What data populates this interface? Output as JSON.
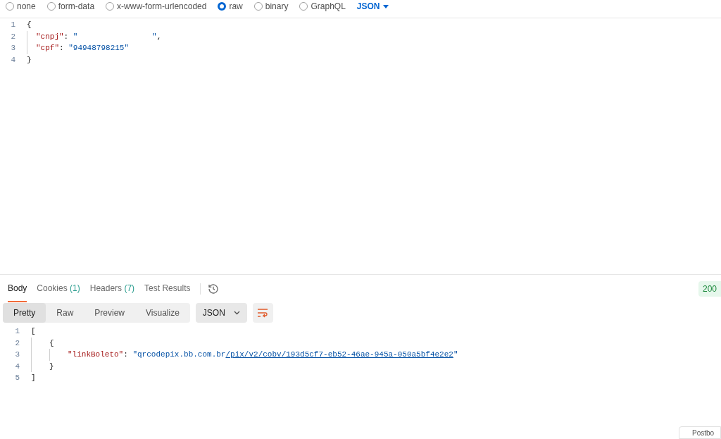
{
  "body_types": [
    {
      "label": "none",
      "selected": false
    },
    {
      "label": "form-data",
      "selected": false
    },
    {
      "label": "x-www-form-urlencoded",
      "selected": false
    },
    {
      "label": "raw",
      "selected": true
    },
    {
      "label": "binary",
      "selected": false
    },
    {
      "label": "GraphQL",
      "selected": false
    }
  ],
  "language_dropdown": "JSON",
  "request_lines": [
    {
      "number": "1",
      "segments": [
        {
          "kind": "punct",
          "text": "{"
        }
      ]
    },
    {
      "number": "2",
      "segments": [
        {
          "kind": "indent"
        },
        {
          "kind": "key",
          "text": "\"cnpj\""
        },
        {
          "kind": "punct",
          "text": ": "
        },
        {
          "kind": "string",
          "text": "\"                \""
        },
        {
          "kind": "punct",
          "text": ","
        }
      ]
    },
    {
      "number": "3",
      "segments": [
        {
          "kind": "indent"
        },
        {
          "kind": "key",
          "text": "\"cpf\""
        },
        {
          "kind": "punct",
          "text": ": "
        },
        {
          "kind": "string",
          "text": "\"94948798215\""
        }
      ]
    },
    {
      "number": "4",
      "segments": [
        {
          "kind": "punct",
          "text": "}"
        }
      ]
    }
  ],
  "response_tabs": [
    {
      "label": "Body",
      "selected": true
    },
    {
      "label": "Cookies",
      "count": "(1)",
      "selected": false
    },
    {
      "label": "Headers",
      "count": "(7)",
      "selected": false
    },
    {
      "label": "Test Results",
      "selected": false
    }
  ],
  "status": "200",
  "view_modes": [
    {
      "label": "Pretty",
      "selected": true
    },
    {
      "label": "Raw",
      "selected": false
    },
    {
      "label": "Preview",
      "selected": false
    },
    {
      "label": "Visualize",
      "selected": false
    }
  ],
  "format_dropdown": "JSON",
  "response_lines": [
    {
      "number": "1",
      "segments": [
        {
          "kind": "punct",
          "text": "["
        }
      ]
    },
    {
      "number": "2",
      "segments": [
        {
          "kind": "wide_indent"
        },
        {
          "kind": "punct",
          "text": "{"
        }
      ]
    },
    {
      "number": "3",
      "segments": [
        {
          "kind": "wide_indent"
        },
        {
          "kind": "wide_indent"
        },
        {
          "kind": "key",
          "text": "\"linkBoleto\""
        },
        {
          "kind": "punct",
          "text": ": "
        },
        {
          "kind": "string",
          "text": "\"qrcodepix.bb.com.br"
        },
        {
          "kind": "link",
          "text": "/pix/v2/cobv/193d5cf7-eb52-46ae-945a-050a5bf4e2e2"
        },
        {
          "kind": "string",
          "text": "\""
        }
      ]
    },
    {
      "number": "4",
      "segments": [
        {
          "kind": "wide_indent"
        },
        {
          "kind": "punct",
          "text": "}"
        }
      ]
    },
    {
      "number": "5",
      "segments": [
        {
          "kind": "punct",
          "text": "]"
        }
      ]
    }
  ],
  "footer_card": "Postbo"
}
